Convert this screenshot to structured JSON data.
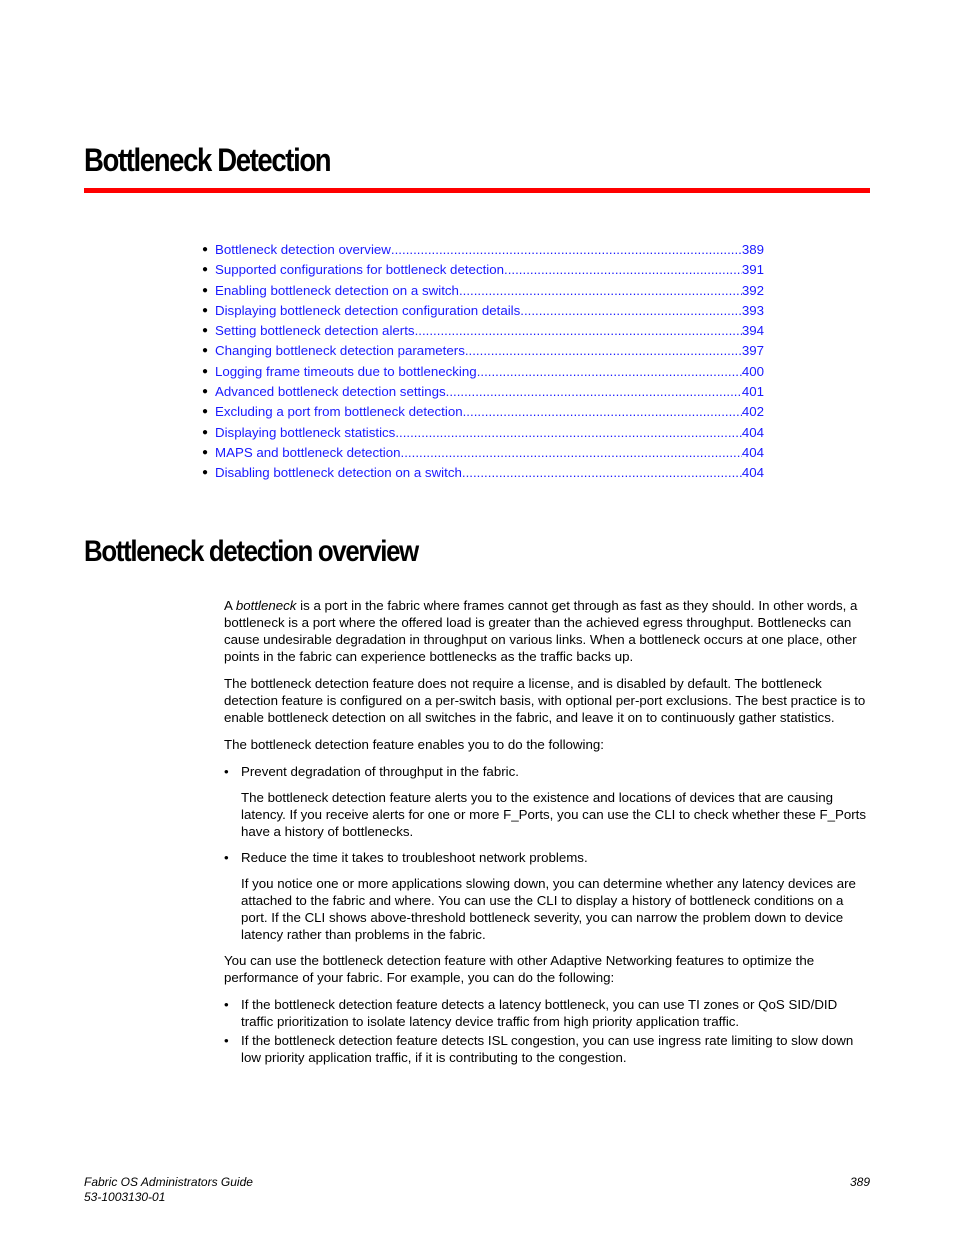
{
  "chapter": {
    "title": "Bottleneck Detection",
    "rule_color": "#ff0000"
  },
  "toc": {
    "link_color": "#1a1aff",
    "items": [
      {
        "label": "Bottleneck detection overview",
        "page": "389"
      },
      {
        "label": "Supported configurations for bottleneck detection",
        "page": "391"
      },
      {
        "label": "Enabling bottleneck detection on a switch",
        "page": "392"
      },
      {
        "label": "Displaying bottleneck detection configuration details",
        "page": "393"
      },
      {
        "label": "Setting bottleneck detection alerts",
        "page": "394"
      },
      {
        "label": "Changing bottleneck detection parameters",
        "page": "397"
      },
      {
        "label": "Logging frame timeouts due to bottlenecking",
        "page": "400"
      },
      {
        "label": "Advanced bottleneck detection settings",
        "page": "401"
      },
      {
        "label": "Excluding a port from bottleneck detection",
        "page": "402"
      },
      {
        "label": "Displaying bottleneck statistics",
        "page": "404"
      },
      {
        "label": "MAPS and bottleneck detection",
        "page": "404"
      },
      {
        "label": "Disabling bottleneck detection on a switch",
        "page": "404"
      }
    ]
  },
  "section": {
    "title": "Bottleneck detection overview",
    "p1_prefix": "A ",
    "p1_term": "bottleneck",
    "p1_rest": " is a port in the fabric where frames cannot get through as fast as they should. In other words, a bottleneck is a port where the offered load is greater than the achieved egress throughput. Bottlenecks can cause undesirable degradation in throughput on various links. When a bottleneck occurs at one place, other points in the fabric can experience bottlenecks as the traffic backs up.",
    "p2": "The bottleneck detection feature does not require a license, and is disabled by default. The bottleneck detection feature is configured on a per-switch basis, with optional per-port exclusions. The best practice is to enable bottleneck detection on all switches in the fabric, and leave it on to continuously gather statistics.",
    "p3": "The bottleneck detection feature enables you to do the following:",
    "bullets1": [
      {
        "text": "Prevent degradation of throughput in the fabric.",
        "detail": "The bottleneck detection feature alerts you to the existence and locations of devices that are causing latency. If you receive alerts for one or more F_Ports, you can use the CLI to check whether these F_Ports have a history of bottlenecks."
      },
      {
        "text": "Reduce the time it takes to troubleshoot network problems.",
        "detail": "If you notice one or more applications slowing down, you can determine whether any latency devices are attached to the fabric and where. You can use the CLI to display a history of bottleneck conditions on a port. If the CLI shows above-threshold bottleneck severity, you can narrow the problem down to device latency rather than problems in the fabric."
      }
    ],
    "p4": "You can use the bottleneck detection feature with other Adaptive Networking features to optimize the performance of your fabric. For example, you can do the following:",
    "bullets2": [
      "If the bottleneck detection feature detects a latency bottleneck, you can use TI zones or QoS SID/DID traffic prioritization to isolate latency device traffic from high priority application traffic.",
      "If the bottleneck detection feature detects ISL congestion, you can use ingress rate limiting to slow down low priority application traffic, if it is contributing to the congestion."
    ],
    "bullet_glyph": "•"
  },
  "footer": {
    "doc_title": "Fabric OS Administrators Guide",
    "doc_number": "53-1003130-01",
    "page_number": "389"
  }
}
